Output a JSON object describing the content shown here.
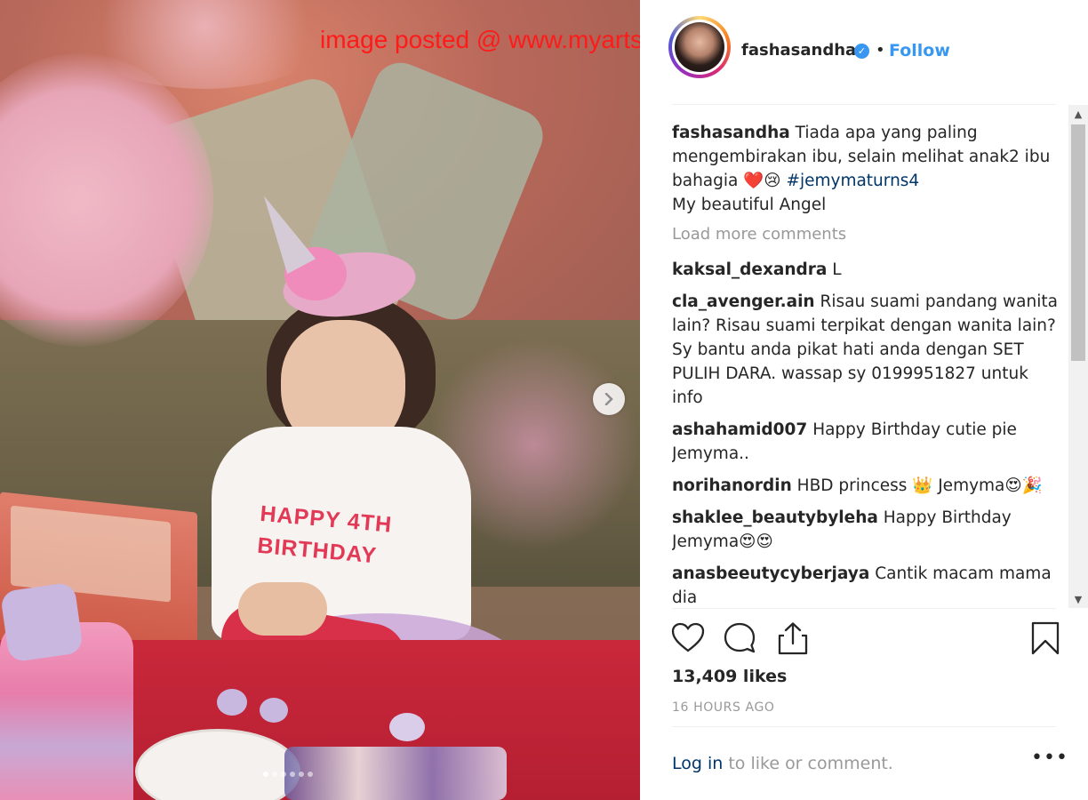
{
  "watermark": "image posted @ www.myarts.com",
  "photo": {
    "shirt_line1": "HAPPY 4TH",
    "shirt_line2": "BIRTHDAY",
    "next_icon": "chevron-right-icon",
    "carousel_dots": 6,
    "carousel_active": 0
  },
  "header": {
    "username": "fashasandha",
    "verified_icon": "verified-badge-icon",
    "separator": "•",
    "follow_label": "Follow"
  },
  "caption": {
    "username": "fashasandha",
    "text": "Tiada apa yang paling mengembirakan ibu, selain melihat anak2 ibu bahagia ❤️😢",
    "hashtag": "#jemymaturns4",
    "line2": "My beautiful Angel"
  },
  "load_more": "Load more comments",
  "comments": [
    {
      "user": "kaksal_dexandra",
      "text": "L"
    },
    {
      "user": "cla_avenger.ain",
      "text": "Risau suami pandang wanita lain? Risau suami terpikat dengan wanita lain? Sy bantu anda pikat hati anda dengan SET PULIH DARA. wassap sy 0199951827 untuk info"
    },
    {
      "user": "ashahamid007",
      "text": "Happy Birthday cutie pie Jemyma.."
    },
    {
      "user": "norihanordin",
      "text": "HBD princess 👑 Jemyma😍🎉"
    },
    {
      "user": "shaklee_beautybyleha",
      "text": "Happy Birthday Jemyma😍😍"
    },
    {
      "user": "anasbeeutycyberjaya",
      "text": "Cantik macam mama dia"
    }
  ],
  "actions": {
    "like_icon": "heart-icon",
    "comment_icon": "comment-bubble-icon",
    "share_icon": "share-icon",
    "save_icon": "bookmark-icon"
  },
  "likes": "13,409 likes",
  "time_ago": "16 HOURS AGO",
  "login": {
    "link": "Log in",
    "rest": " to like or comment."
  },
  "more_label": "•••",
  "colors": {
    "follow": "#3897f0",
    "hashtag": "#003569",
    "muted": "#999999",
    "watermark": "#ff1a1a"
  }
}
